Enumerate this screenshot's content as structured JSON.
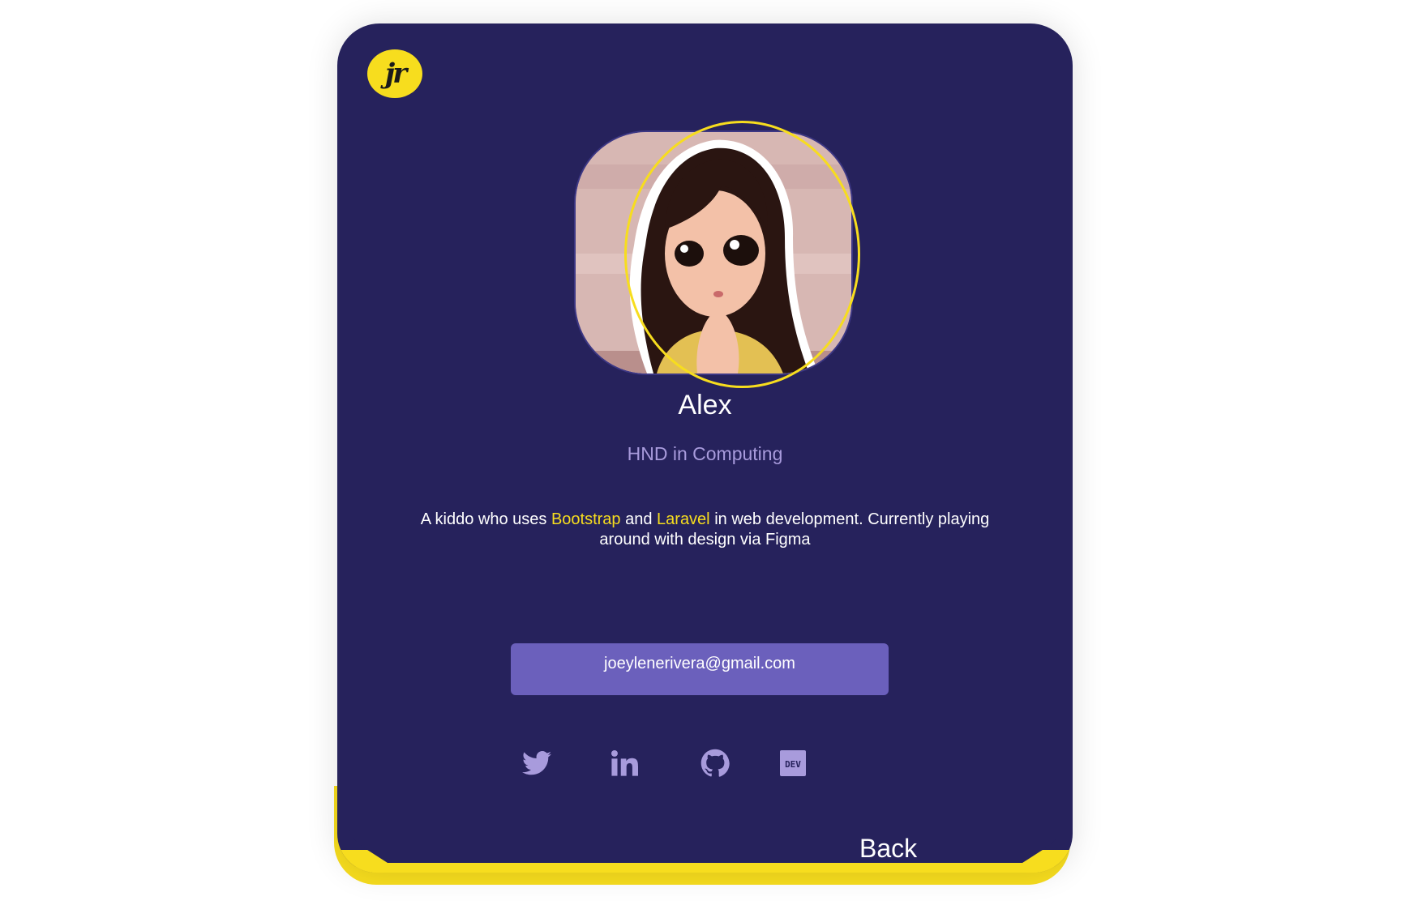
{
  "brand": {
    "logo_text": "jr",
    "accent_color": "#f7dd1e",
    "card_color": "#26225c",
    "button_color": "#6b60bc",
    "muted_color": "#a89bdc"
  },
  "profile": {
    "avatar_alt": "avatar-illustration",
    "name": "Alex",
    "degree": "HND in  Computing",
    "bio": {
      "part1": "A kiddo who uses ",
      "highlight1": "Bootstrap",
      "part2": " and ",
      "highlight2": "Laravel",
      "part3": " in web development. Currently playing around with design via Figma"
    }
  },
  "contact": {
    "email": "joeylenerivera@gmail.com"
  },
  "socials": [
    {
      "icon": "twitter-icon"
    },
    {
      "icon": "linkedin-icon"
    },
    {
      "icon": "github-icon"
    },
    {
      "icon": "dev-icon",
      "text": "DEV"
    }
  ],
  "navigation": {
    "back_label": "Back"
  }
}
